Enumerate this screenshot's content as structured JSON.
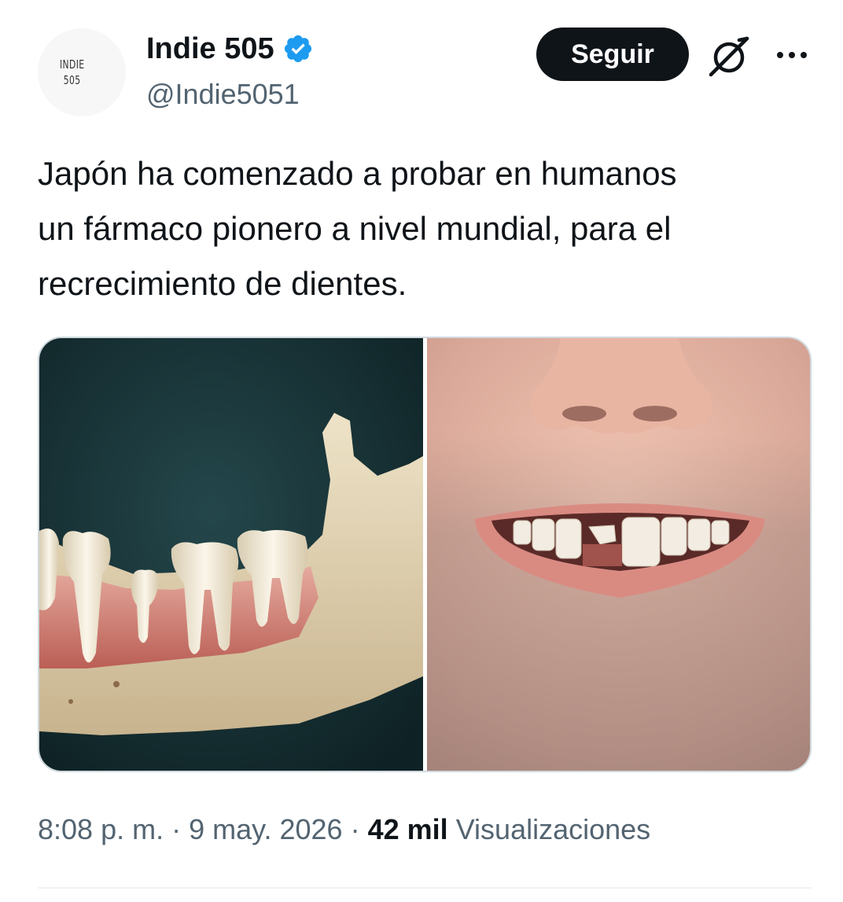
{
  "author": {
    "avatar_text_line1": "INDIE",
    "avatar_text_line2": "505",
    "display_name": "Indie 505",
    "handle": "@Indie5051",
    "verified": true
  },
  "actions": {
    "follow_label": "Seguir",
    "grok_icon": "grok-icon",
    "more_icon": "more-icon"
  },
  "tweet": {
    "text": "Japón ha comenzado a probar en humanos\nun fármaco pionero a nivel mundial, para el\nrecrecimiento de dientes."
  },
  "meta": {
    "time": "8:08 p. m.",
    "separator": "·",
    "date": "9 may. 2026",
    "views_count": "42 mil",
    "views_label": "Visualizaciones"
  },
  "colors": {
    "text_primary": "#0f1419",
    "text_secondary": "#536471",
    "verified_blue": "#1d9bf0",
    "button_bg": "#0f1419",
    "border": "#cfd9de"
  }
}
